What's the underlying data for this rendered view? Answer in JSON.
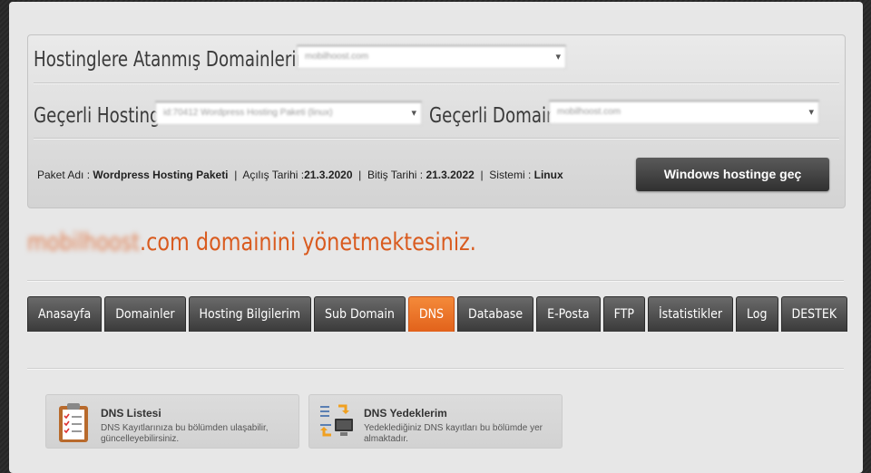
{
  "labels": {
    "assigned_domains": "Hostinglere Atanmış Domainlerim",
    "current_hosting": "Geçerli Hosting",
    "current_domain": "Geçerli Domain"
  },
  "selects": {
    "assigned_domain_value": "mobilhoost.com",
    "hosting_value": "id:70412 Wordpress Hosting Paketi (linux)",
    "domain_value": "mobilhoost.com"
  },
  "info": {
    "package_label": "Paket Adı : ",
    "package_value": "Wordpress Hosting Paketi",
    "open_label": "  |  Açılış Tarihi :",
    "open_value": "21.3.2020",
    "end_label": "  |  Bitiş Tarihi : ",
    "end_value": "21.3.2022",
    "system_label": "  |  Sistemi : ",
    "system_value": "Linux"
  },
  "switch_button": "Windows hostinge geç",
  "headline": {
    "domain_blurred": "mobilhoost",
    "text": ".com domainini yönetmektesiniz."
  },
  "tabs": [
    "Anasayfa",
    "Domainler",
    "Hosting Bilgilerim",
    "Sub Domain",
    "DNS",
    "Database",
    "E-Posta",
    "FTP",
    "İstatistikler",
    "Log",
    "DESTEK"
  ],
  "active_tab": "DNS",
  "cards": [
    {
      "title": "DNS Listesi",
      "desc": "DNS Kayıtlarınıza bu bölümden ulaşabilir, güncelleyebilirsiniz.",
      "icon": "clipboard-list-icon"
    },
    {
      "title": "DNS Yedeklerim",
      "desc": "Yedeklediğiniz DNS kayıtları bu bölümde yer almaktadır.",
      "icon": "server-backup-icon"
    }
  ],
  "colors": {
    "accent": "#e2621b",
    "headline": "#d95b1f",
    "dark_button": "#3a3a3a"
  }
}
